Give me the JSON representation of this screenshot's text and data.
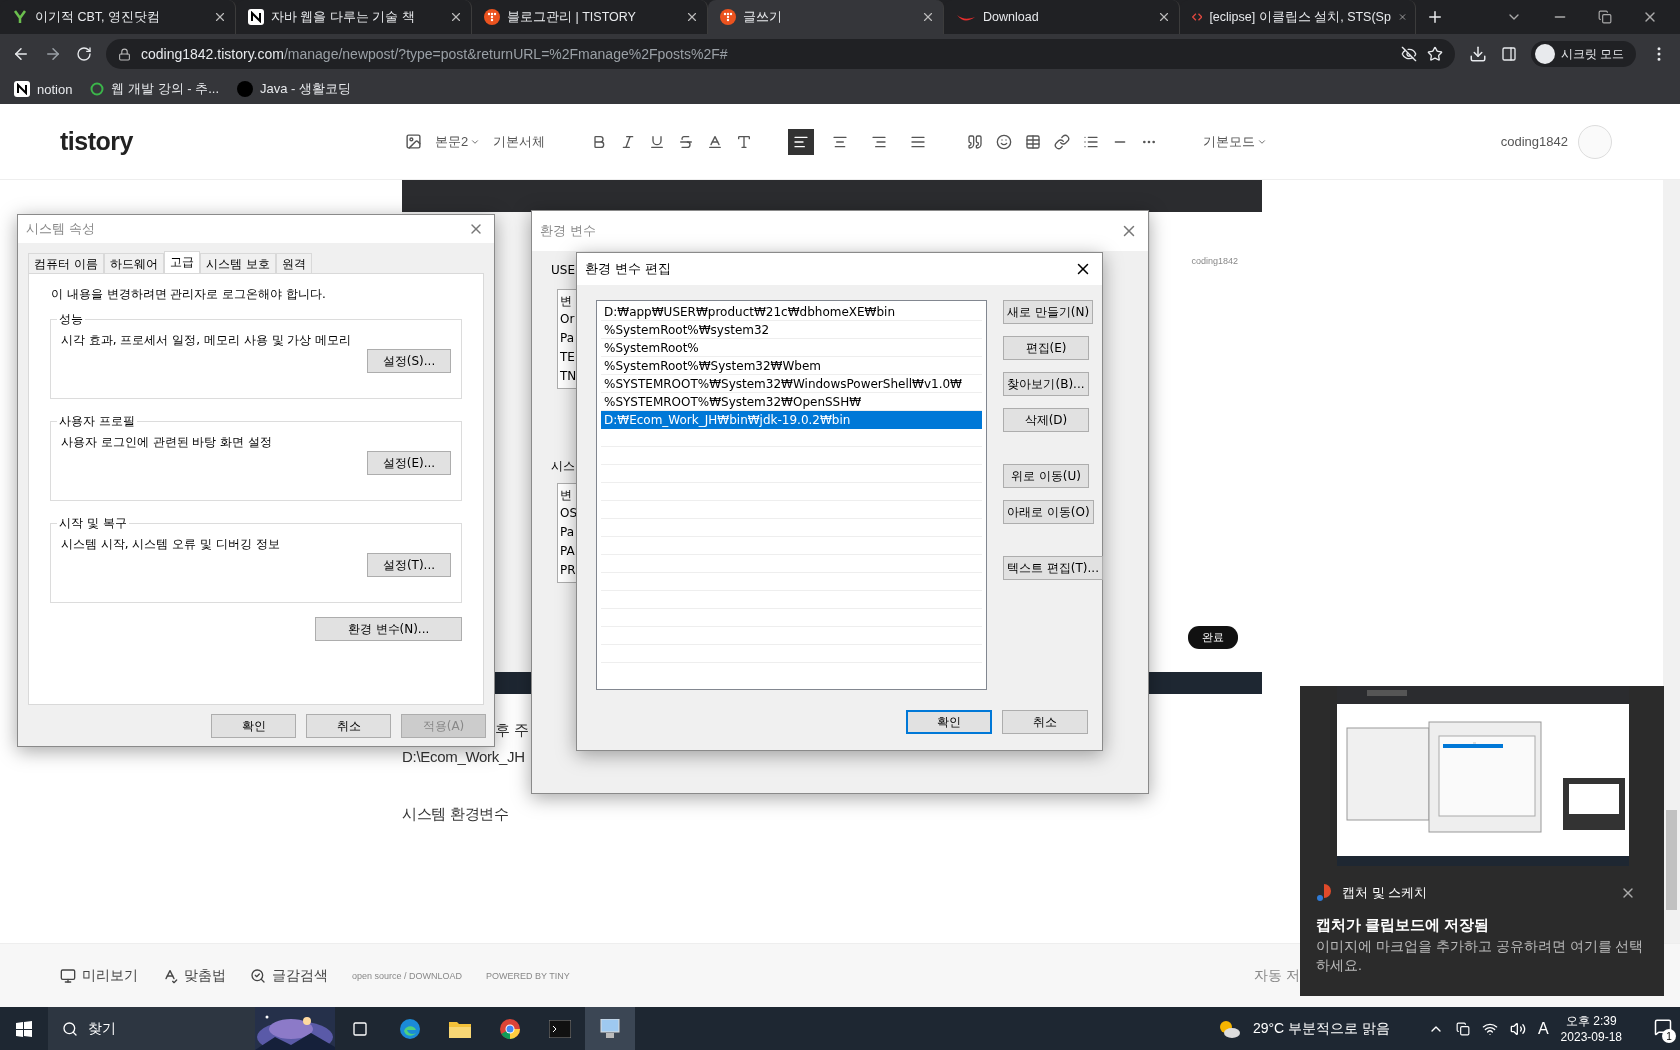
{
  "browser": {
    "tabs": [
      {
        "title": "이기적 CBT, 영진닷컴",
        "selected": false
      },
      {
        "title": "자바 웹을 다루는 기술 책",
        "selected": false
      },
      {
        "title": "블로그관리 | TISTORY",
        "selected": false
      },
      {
        "title": "글쓰기",
        "selected": true
      },
      {
        "title": "Download",
        "selected": false
      },
      {
        "title": "[eclipse] 이클립스 설치, STS(Sp",
        "selected": false
      }
    ],
    "url_host": "coding1842.tistory.com",
    "url_path": "/manage/newpost/?type=post&returnURL=%2Fmanage%2Fposts%2F#",
    "profile": "시크릿 모드",
    "bookmarks": [
      "notion",
      "웹 개발 강의 - 추...",
      "Java - 생활코딩"
    ]
  },
  "editor": {
    "logo": "tistory",
    "paragraph": "본문2",
    "font": "기본서체",
    "mode": "기본모드",
    "user": "coding1842",
    "alignment": [
      {
        "selected": true
      },
      {
        "selected": false
      },
      {
        "selected": false
      },
      {
        "selected": false
      }
    ],
    "embedded": {
      "user": "coding1842",
      "done": "완료"
    },
    "lines": [
      "후 주",
      "D:\\Ecom_Work_JH",
      "시스템 환경변수"
    ],
    "footer": [
      "미리보기",
      "맞춤법",
      "글감검색"
    ],
    "credits": [
      "open source / DOWNLOAD",
      "POWERED BY TINY"
    ],
    "autosave": "자동 저"
  },
  "system_properties": {
    "title": "시스템 속성",
    "tabs": [
      {
        "label": "컴퓨터 이름",
        "selected": false
      },
      {
        "label": "하드웨어",
        "selected": false
      },
      {
        "label": "고급",
        "selected": true
      },
      {
        "label": "시스템 보호",
        "selected": false
      },
      {
        "label": "원격",
        "selected": false
      }
    ],
    "notice": "이 내용을 변경하려면 관리자로 로그온해야 합니다.",
    "groups": [
      {
        "title": "성능",
        "description": "시각 효과, 프로세서 일정, 메모리 사용 및 가상 메모리",
        "button": "설정(S)..."
      },
      {
        "title": "사용자 프로필",
        "description": "사용자 로그인에 관련된 바탕 화면 설정",
        "button": "설정(E)..."
      },
      {
        "title": "시작 및 복구",
        "description": "시스템 시작, 시스템 오류 및 디버깅 정보",
        "button": "설정(T)..."
      }
    ],
    "env_button": "환경 변수(N)...",
    "buttons": [
      {
        "label": "확인",
        "disabled": false
      },
      {
        "label": "취소",
        "disabled": false
      },
      {
        "label": "적용(A)",
        "disabled": true
      }
    ]
  },
  "environment_variables": {
    "title": "환경 변수",
    "user_group": "USE",
    "user_rows": [
      "변",
      "Or",
      "Pa",
      "TE",
      "TN"
    ],
    "system_group": "시스",
    "system_rows": [
      "변",
      "OS",
      "Pa",
      "PA",
      "PR"
    ]
  },
  "edit_dialog": {
    "title": "환경 변수 편집",
    "rows": [
      {
        "text": "D:₩app₩USER₩product₩21c₩dbhomeXE₩bin",
        "selected": false
      },
      {
        "text": "%SystemRoot%₩system32",
        "selected": false
      },
      {
        "text": "%SystemRoot%",
        "selected": false
      },
      {
        "text": "%SystemRoot%₩System32₩Wbem",
        "selected": false
      },
      {
        "text": "%SYSTEMROOT%₩System32₩WindowsPowerShell₩v1.0₩",
        "selected": false
      },
      {
        "text": "%SYSTEMROOT%₩System32₩OpenSSH₩",
        "selected": false
      },
      {
        "text": "D:₩Ecom_Work_JH₩bin₩jdk-19.0.2₩bin",
        "selected": true
      }
    ],
    "side_button_groups": [
      [
        "새로 만들기(N)",
        "편집(E)",
        "찾아보기(B)...",
        "삭제(D)"
      ],
      [
        "위로 이동(U)",
        "아래로 이동(O)"
      ],
      [
        "텍스트 편집(T)..."
      ]
    ],
    "buttons": [
      {
        "label": "확인",
        "default": true
      },
      {
        "label": "취소",
        "default": false
      }
    ]
  },
  "notification": {
    "app": "캡처 및 스케치",
    "title": "캡처가 클립보드에 저장됨",
    "body": "이미지에 마크업을 추가하고 공유하려면 여기를 선택하세요."
  },
  "taskbar": {
    "search": "찾기",
    "weather": "29°C 부분적으로 맑음",
    "ime": "A",
    "time": "오후 2:39",
    "date": "2023-09-18",
    "badge": "1"
  }
}
